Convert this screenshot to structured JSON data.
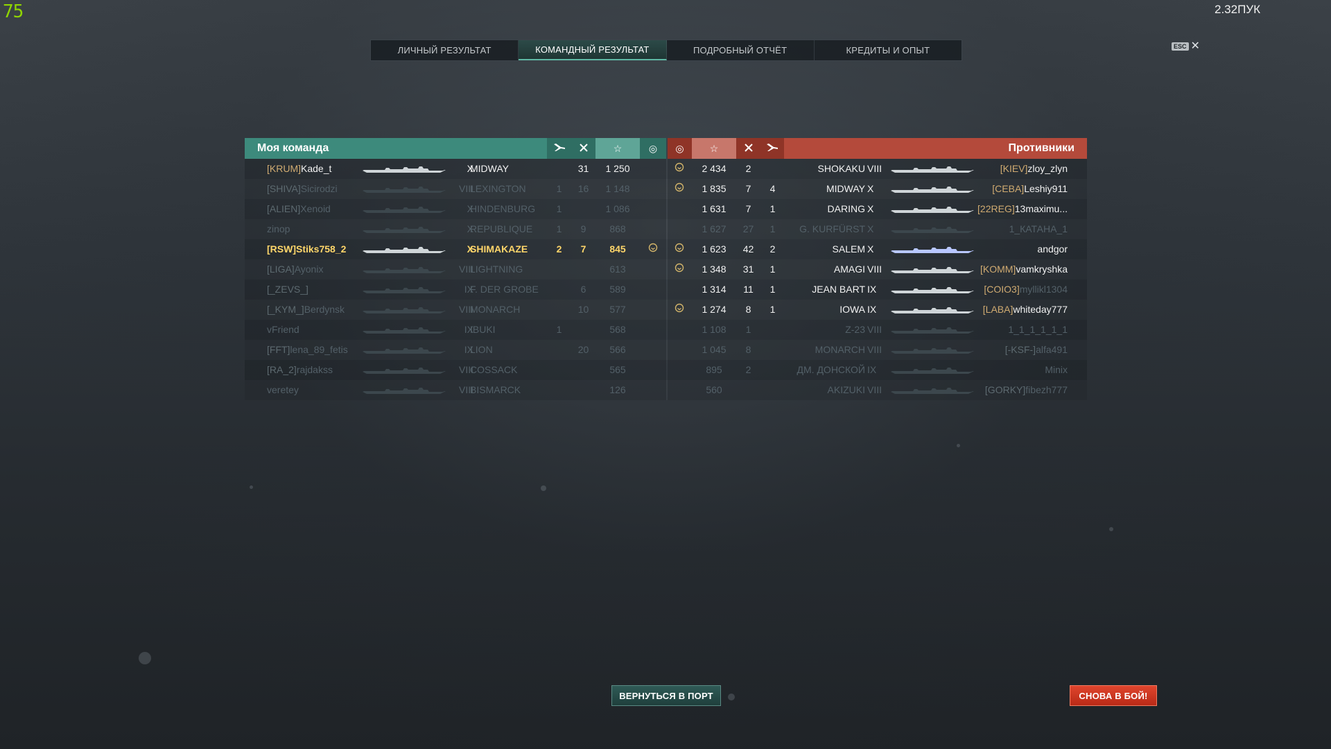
{
  "fps": "75",
  "clock": "2.32ПУК",
  "tabs": [
    {
      "label": "ЛИЧНЫЙ РЕЗУЛЬТАТ",
      "active": false
    },
    {
      "label": "КОМАНДНЫЙ РЕЗУЛЬТАТ",
      "active": true
    },
    {
      "label": "ПОДРОБНЫЙ ОТЧЁТ",
      "active": false
    },
    {
      "label": "КРЕДИТЫ И ОПЫТ",
      "active": false
    }
  ],
  "esc": {
    "badge": "ESC",
    "close": "✕"
  },
  "left_team": {
    "title": "Моя команда",
    "columns": [
      "plane-icon",
      "kills-icon",
      "star-icon",
      "clock-icon"
    ],
    "accent": "#3d8a7c",
    "players": [
      {
        "clan": "[KRUM]",
        "name": "Kade_t",
        "tier": "X",
        "ship": "MIDWAY",
        "planes": "",
        "kills": "31",
        "exp": "1 250",
        "medal": false,
        "state": "alive"
      },
      {
        "clan": "[SHIVA]",
        "name": "Sicirodzi",
        "tier": "VIII",
        "ship": "LEXINGTON",
        "planes": "1",
        "kills": "16",
        "exp": "1 148",
        "medal": false,
        "state": "dead"
      },
      {
        "clan": "[ALIEN]",
        "name": "Xenoid",
        "tier": "X",
        "ship": "HINDENBURG",
        "planes": "1",
        "kills": "",
        "exp": "1 086",
        "medal": false,
        "state": "dead"
      },
      {
        "clan": "",
        "name": "zinop",
        "tier": "X",
        "ship": "REPUBLIQUE",
        "planes": "1",
        "kills": "9",
        "exp": "868",
        "medal": false,
        "state": "dead"
      },
      {
        "clan": "[RSW]",
        "name": "Stiks758_2",
        "tier": "X",
        "ship": "SHIMAKAZE",
        "planes": "2",
        "kills": "7",
        "exp": "845",
        "medal": true,
        "state": "self"
      },
      {
        "clan": "[LIGA]",
        "name": "Ayonix",
        "tier": "VIII",
        "ship": "LIGHTNING",
        "planes": "",
        "kills": "",
        "exp": "613",
        "medal": false,
        "state": "dead"
      },
      {
        "clan": "[_ZEVS_]",
        "name": "",
        "tier": "IX",
        "ship": "F. DER GROBE",
        "planes": "",
        "kills": "6",
        "exp": "589",
        "medal": false,
        "state": "dead"
      },
      {
        "clan": "[_KYM_]",
        "name": "Berdynsk",
        "tier": "VIII",
        "ship": "MONARCH",
        "planes": "",
        "kills": "10",
        "exp": "577",
        "medal": false,
        "state": "dead"
      },
      {
        "clan": "",
        "name": "vFriend",
        "tier": "IX",
        "ship": "IBUKI",
        "planes": "1",
        "kills": "",
        "exp": "568",
        "medal": false,
        "state": "dead"
      },
      {
        "clan": "[FFT]",
        "name": "lena_89_fetis",
        "tier": "IX",
        "ship": "LION",
        "planes": "",
        "kills": "20",
        "exp": "566",
        "medal": false,
        "state": "dead"
      },
      {
        "clan": "[RA_2]",
        "name": "rajdakss",
        "tier": "VIII",
        "ship": "COSSACK",
        "planes": "",
        "kills": "",
        "exp": "565",
        "medal": false,
        "state": "dead"
      },
      {
        "clan": "",
        "name": "veretey",
        "tier": "VIII",
        "ship": "BISMARCK",
        "planes": "",
        "kills": "",
        "exp": "126",
        "medal": false,
        "state": "dead"
      }
    ]
  },
  "right_team": {
    "title": "Противники",
    "accent": "#b44a3b",
    "players": [
      {
        "clan": "[KIEV]",
        "name": "zloy_zlyn",
        "tier": "VIII",
        "ship": "SHOKAKU",
        "planes": "",
        "kills": "2",
        "exp": "2 434",
        "medal": true,
        "state": "alive"
      },
      {
        "clan": "[CEBA]",
        "name": "Leshiy911",
        "tier": "X",
        "ship": "MIDWAY",
        "planes": "4",
        "kills": "7",
        "exp": "1 835",
        "medal": true,
        "state": "alive"
      },
      {
        "clan": "[22REG]",
        "name": "13maximu...",
        "tier": "X",
        "ship": "DARING",
        "planes": "1",
        "kills": "7",
        "exp": "1 631",
        "medal": false,
        "state": "alive"
      },
      {
        "clan": "",
        "name": "1_КАТАНА_1",
        "tier": "X",
        "ship": "G. KURFÜRST",
        "planes": "1",
        "kills": "27",
        "exp": "1 627",
        "medal": false,
        "state": "dead"
      },
      {
        "clan": "",
        "name": "andgor",
        "tier": "X",
        "ship": "SALEM",
        "planes": "2",
        "kills": "42",
        "exp": "1 623",
        "medal": true,
        "state": "alive"
      },
      {
        "clan": "[KOMM]",
        "name": "vamkryshka",
        "tier": "VIII",
        "ship": "AMAGI",
        "planes": "1",
        "kills": "31",
        "exp": "1 348",
        "medal": true,
        "state": "alive"
      },
      {
        "clan": "[COIO3]",
        "name": "myllikl1304",
        "tier": "IX",
        "ship": "JEAN BART",
        "planes": "1",
        "kills": "11",
        "exp": "1 314",
        "medal": false,
        "state": "half"
      },
      {
        "clan": "[LABA]",
        "name": "whiteday777",
        "tier": "IX",
        "ship": "IOWA",
        "planes": "1",
        "kills": "8",
        "exp": "1 274",
        "medal": true,
        "state": "alive"
      },
      {
        "clan": "",
        "name": "1_1_1_1_1_1",
        "tier": "VIII",
        "ship": "Z-23",
        "planes": "",
        "kills": "1",
        "exp": "1 108",
        "medal": false,
        "state": "dead"
      },
      {
        "clan": "[-KSF-]",
        "name": "alfa491",
        "tier": "VIII",
        "ship": "MONARCH",
        "planes": "",
        "kills": "8",
        "exp": "1 045",
        "medal": false,
        "state": "dead"
      },
      {
        "clan": "",
        "name": "Minix",
        "tier": "IX",
        "ship": "ДМ. ДОНСКОЙ",
        "planes": "",
        "kills": "2",
        "exp": "895",
        "medal": false,
        "state": "dead"
      },
      {
        "clan": "[GORKY]",
        "name": "fibezh777",
        "tier": "VIII",
        "ship": "AKIZUKI",
        "planes": "",
        "kills": "",
        "exp": "560",
        "medal": false,
        "state": "dead"
      }
    ]
  },
  "buttons": {
    "return_port": "ВЕРНУТЬСЯ В ПОРТ",
    "battle_again": "СНОВА В БОЙ!"
  }
}
